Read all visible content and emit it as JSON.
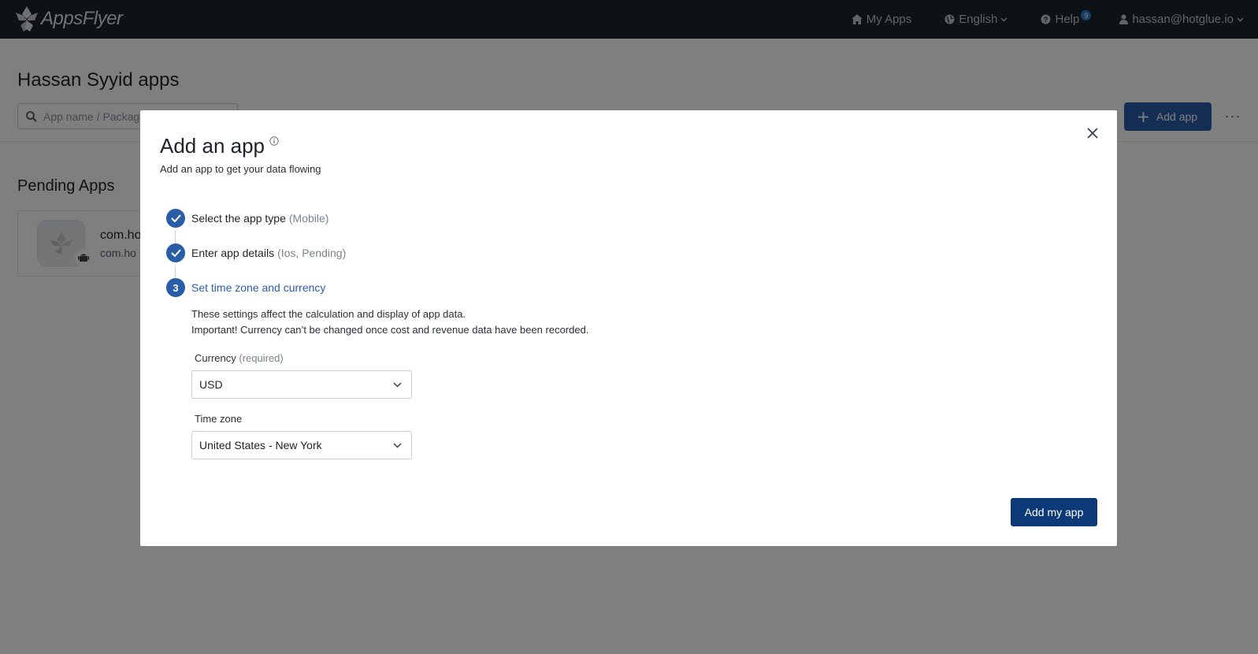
{
  "nav": {
    "logo_text": "AppsFlyer",
    "my_apps": "My Apps",
    "language": "English",
    "help": "Help",
    "help_badge": "9",
    "user": "hassan@hotglue.io"
  },
  "page": {
    "title": "Hassan Syyid apps",
    "search_placeholder": "App name / Package",
    "add_app_label": "Add app",
    "more_label": "···",
    "pending_title": "Pending Apps",
    "pending_app": {
      "name": "com.ho",
      "package": "com.ho"
    }
  },
  "modal": {
    "title": "Add an app",
    "subtitle": "Add an app to get your data flowing",
    "steps": [
      {
        "number": "1",
        "label": "Select the app type",
        "detail": "(Mobile)",
        "status": "done"
      },
      {
        "number": "2",
        "label": "Enter app details",
        "detail": "(Ios, Pending)",
        "status": "done"
      },
      {
        "number": "3",
        "label": "Set time zone and currency",
        "detail": "",
        "status": "active"
      }
    ],
    "note_line1": "These settings affect the calculation and display of app data.",
    "note_line2": "Important! Currency can’t be changed once cost and revenue data have been recorded.",
    "currency": {
      "label": "Currency",
      "required": "(required)",
      "value": "USD"
    },
    "timezone": {
      "label": "Time zone",
      "value": "United States - New York"
    },
    "submit_label": "Add my app"
  },
  "colors": {
    "topbar": "#1d242d",
    "primary": "#2a5da8",
    "submit": "#0c3a78"
  }
}
